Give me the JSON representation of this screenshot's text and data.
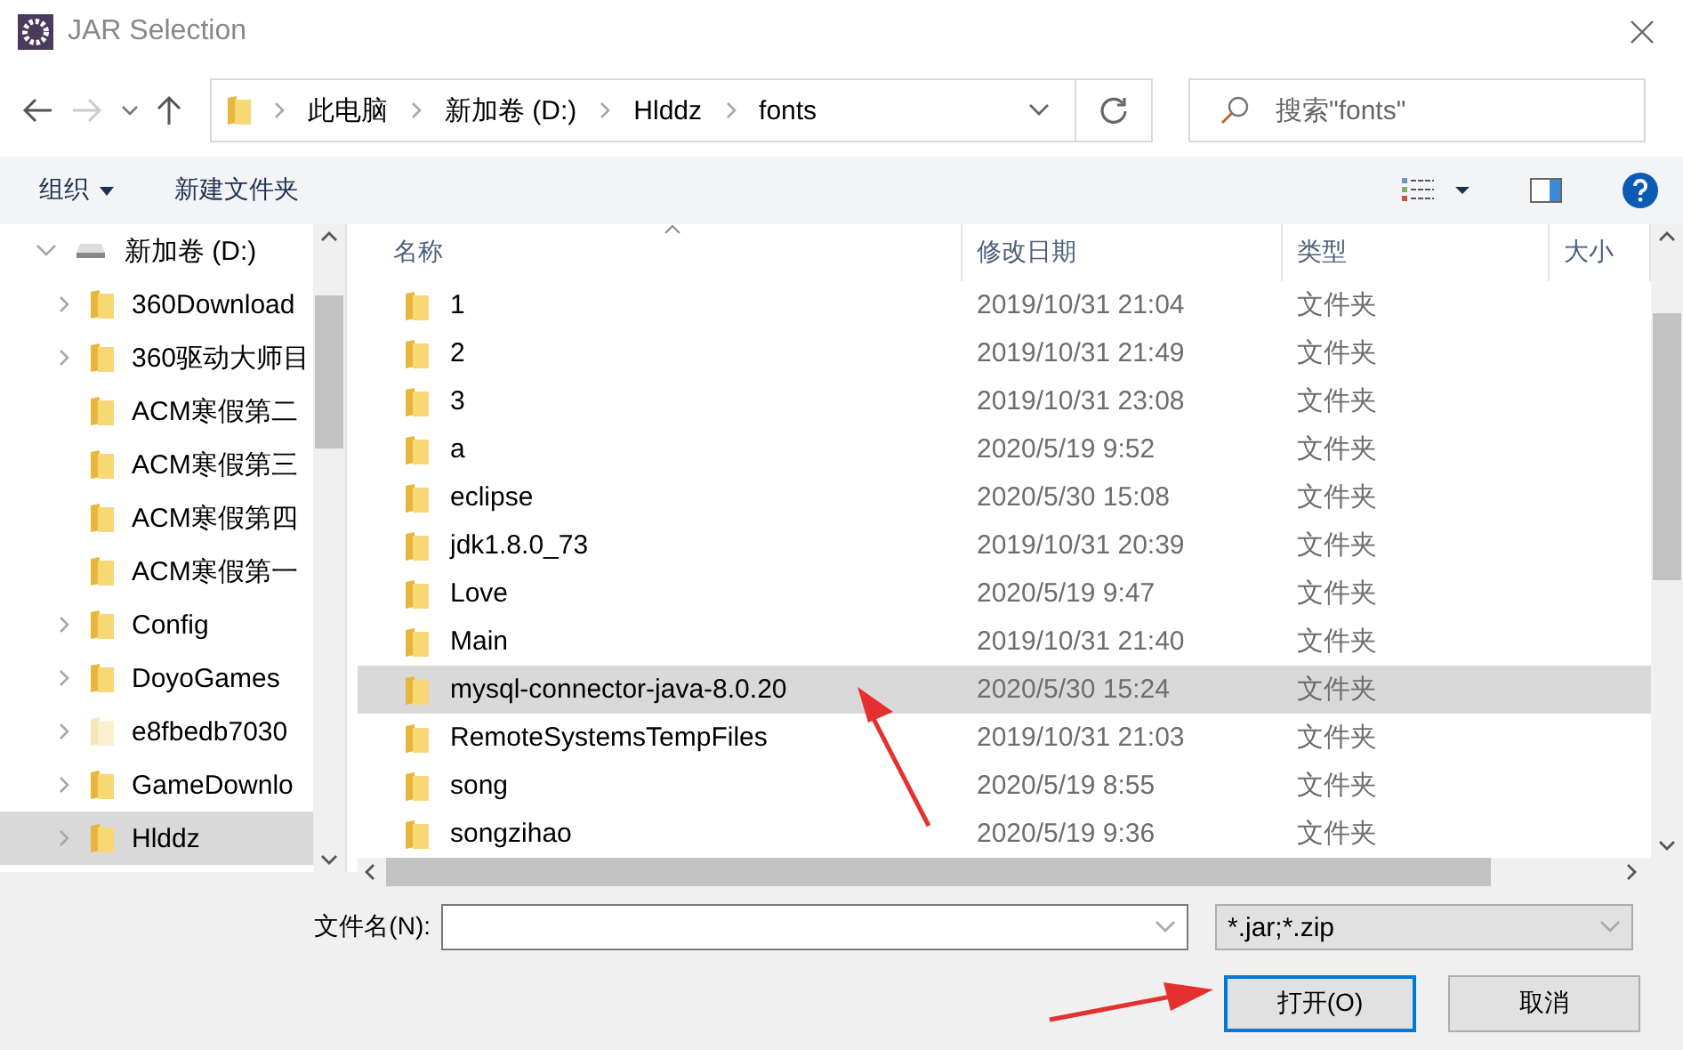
{
  "window": {
    "title": "JAR Selection"
  },
  "address": {
    "path": [
      "此电脑",
      "新加卷 (D:)",
      "Hlddz",
      "fonts"
    ]
  },
  "search": {
    "placeholder": "搜索\"fonts\""
  },
  "toolbar": {
    "organize": "组织",
    "new_folder": "新建文件夹"
  },
  "sidebar": {
    "items": [
      {
        "label": "新加卷 (D:)",
        "kind": "drive",
        "expanded": true,
        "selected": false,
        "children": [
          {
            "label": "360Download",
            "kind": "folder",
            "expandable": true,
            "selected": false,
            "faded": false
          },
          {
            "label": "360驱动大师目",
            "kind": "folder",
            "expandable": true,
            "selected": false,
            "faded": false
          },
          {
            "label": "ACM寒假第二",
            "kind": "folder",
            "expandable": false,
            "selected": false,
            "faded": false
          },
          {
            "label": "ACM寒假第三",
            "kind": "folder",
            "expandable": false,
            "selected": false,
            "faded": false
          },
          {
            "label": "ACM寒假第四",
            "kind": "folder",
            "expandable": false,
            "selected": false,
            "faded": false
          },
          {
            "label": "ACM寒假第一",
            "kind": "folder",
            "expandable": false,
            "selected": false,
            "faded": false
          },
          {
            "label": "Config",
            "kind": "folder",
            "expandable": true,
            "selected": false,
            "faded": false
          },
          {
            "label": "DoyoGames",
            "kind": "folder",
            "expandable": true,
            "selected": false,
            "faded": false
          },
          {
            "label": "e8fbedb7030",
            "kind": "folder",
            "expandable": true,
            "selected": false,
            "faded": true
          },
          {
            "label": "GameDownlo",
            "kind": "folder",
            "expandable": true,
            "selected": false,
            "faded": false
          },
          {
            "label": "Hlddz",
            "kind": "folder",
            "expandable": true,
            "selected": true,
            "faded": false
          }
        ]
      }
    ]
  },
  "table": {
    "columns": [
      "名称",
      "修改日期",
      "类型",
      "大小"
    ],
    "rows": [
      {
        "name": "1",
        "modified": "2019/10/31 21:04",
        "type": "文件夹",
        "selected": false
      },
      {
        "name": "2",
        "modified": "2019/10/31 21:49",
        "type": "文件夹",
        "selected": false
      },
      {
        "name": "3",
        "modified": "2019/10/31 23:08",
        "type": "文件夹",
        "selected": false
      },
      {
        "name": "a",
        "modified": "2020/5/19 9:52",
        "type": "文件夹",
        "selected": false
      },
      {
        "name": "eclipse",
        "modified": "2020/5/30 15:08",
        "type": "文件夹",
        "selected": false
      },
      {
        "name": "jdk1.8.0_73",
        "modified": "2019/10/31 20:39",
        "type": "文件夹",
        "selected": false
      },
      {
        "name": "Love",
        "modified": "2020/5/19 9:47",
        "type": "文件夹",
        "selected": false
      },
      {
        "name": "Main",
        "modified": "2019/10/31 21:40",
        "type": "文件夹",
        "selected": false
      },
      {
        "name": "mysql-connector-java-8.0.20",
        "modified": "2020/5/30 15:24",
        "type": "文件夹",
        "selected": true
      },
      {
        "name": "RemoteSystemsTempFiles",
        "modified": "2019/10/31 21:03",
        "type": "文件夹",
        "selected": false
      },
      {
        "name": "song",
        "modified": "2020/5/19 8:55",
        "type": "文件夹",
        "selected": false
      },
      {
        "name": "songzihao",
        "modified": "2020/5/19 9:36",
        "type": "文件夹",
        "selected": false
      }
    ]
  },
  "file_name": {
    "label": "文件名(N):"
  },
  "file_type": {
    "value": "*.jar;*.zip"
  },
  "buttons": [
    {
      "label": "打开(O)",
      "kind": "default"
    },
    {
      "label": "取消",
      "kind": "normal"
    }
  ]
}
